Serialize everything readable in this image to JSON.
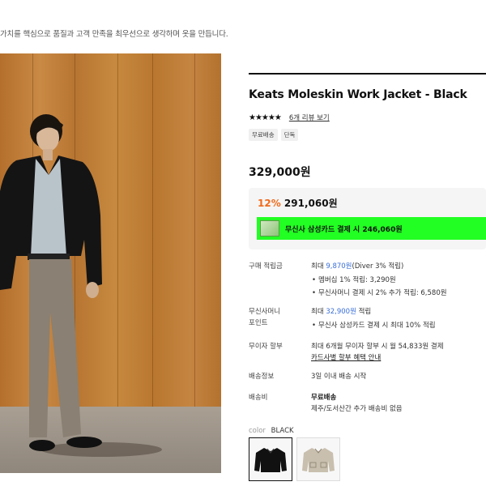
{
  "top_note": "가치를 핵심으로 품질과 고객 만족을 최우선으로 생각하며 옷을 만듭니다.",
  "product": {
    "title": "Keats Moleskin Work Jacket - Black",
    "stars": "★★★★★",
    "rating_out_of_5": 4.5,
    "review_link": "6개 리뷰 보기",
    "tags": [
      "무료배송",
      "단독"
    ],
    "price": "329,000원"
  },
  "promo": {
    "rate": "12%",
    "sale_price": "291,060원",
    "card_text": "무신사 삼성카드 결제 시 246,060원",
    "card_bar_color": "#22ff22",
    "rate_color": "#f06a1c"
  },
  "points": {
    "label": "구매 적립금",
    "prefix": "최대 ",
    "amount": "9,870원",
    "suffix": "(Diver 3% 적립)",
    "item1": "멤버십 1% 적립: 3,290원",
    "item2": "무신사머니 결제 시 2% 추가 적립: 6,580원"
  },
  "money": {
    "label_line1": "무신사머니",
    "label_line2": "포인트",
    "prefix": "최대 ",
    "amount": "32,900원",
    "suffix": " 적립",
    "item1": "무신사 삼성카드 결제 시 최대 10% 적립"
  },
  "installment": {
    "label": "무이자 할부",
    "text": "최대 6개월 무이자 할부 시 월 54,833원 결제",
    "link": "카드사별 할부 혜택 안내"
  },
  "delivery_info": {
    "label": "배송정보",
    "text": "3일 이내 배송 시작"
  },
  "shipping_fee": {
    "label": "배송비",
    "text": "무료배송",
    "note": "제주/도서산간 추가 배송비 없음"
  },
  "color": {
    "label": "color",
    "value": "BLACK",
    "options": [
      "black-jacket-thumbnail",
      "beige-jacket-thumbnail"
    ]
  },
  "colors": {
    "accent_blue": "#3a6fd8",
    "wood_wall": "#c0803a"
  }
}
